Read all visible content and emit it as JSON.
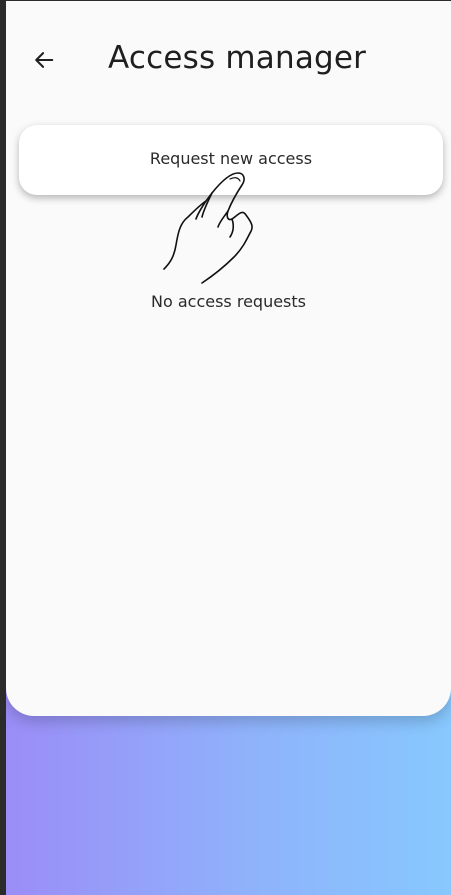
{
  "header": {
    "title": "Access manager"
  },
  "actions": {
    "request_label": "Request new access"
  },
  "list": {
    "empty_text": "No access requests"
  },
  "icons": {
    "back": "arrow-left-icon",
    "gesture": "tap-hand-icon"
  },
  "colors": {
    "sheet_background": "#fafafa",
    "gradient_start": "#9b8cf7",
    "gradient_end": "#87c8fe",
    "text": "#1f1f1f"
  }
}
